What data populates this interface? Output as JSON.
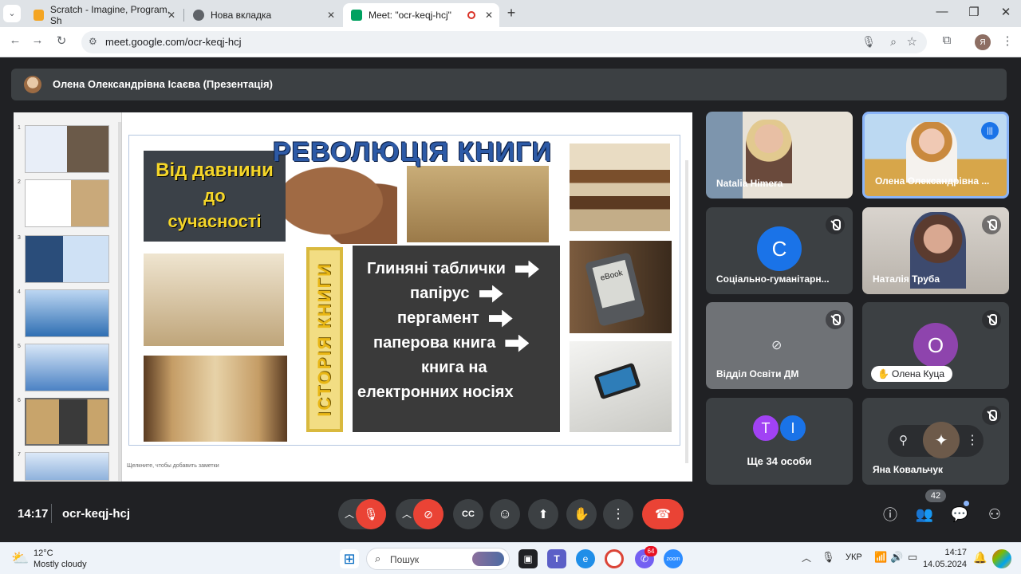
{
  "browser": {
    "tabs": [
      {
        "title": "Scratch - Imagine, Program, Sh",
        "favicon_color": "#f4a522"
      },
      {
        "title": "Нова вкладка",
        "favicon_color": "#5f6368"
      },
      {
        "title": "Meet: \"ocr-keqj-hcj\"",
        "favicon_color": "#00a160"
      }
    ],
    "url": "meet.google.com/ocr-keqj-hcj",
    "profile_initial": "Я"
  },
  "meet": {
    "presenter": "Олена Олександрівна Ісаєва (Презентація)",
    "time": "14:17",
    "meeting_code": "ocr-keqj-hcj",
    "participant_count": "42",
    "participants": [
      {
        "name": "Natalia Himera"
      },
      {
        "name": "Олена Олександрівна ..."
      },
      {
        "name": "Соціально-гуманітарн...",
        "initial": "С",
        "color": "#1a73e8"
      },
      {
        "name": "Наталія Труба"
      },
      {
        "name": "Відділ Освіти ДМ"
      },
      {
        "name": "Олена Куца",
        "initial": "О",
        "color": "#8e44ad"
      },
      {
        "name": "Ще 34 особи",
        "initials": [
          "Т",
          "І"
        ],
        "colors": [
          "#a142f4",
          "#1a73e8"
        ]
      },
      {
        "name": "Яна Ковальчук"
      }
    ]
  },
  "slide": {
    "title": "РЕВОЛЮЦІЯ КНИГИ",
    "ages_lines": [
      "Від давнини",
      "до",
      "сучасності"
    ],
    "spine_text": "ІСТОРІЯ КНИГИ",
    "items": [
      "Глиняні таблички",
      "папірус",
      "пергамент",
      "паперова книга",
      "книга на",
      "електронних носіях"
    ],
    "ebook_label": "eBook",
    "notes_hint": "Щелкните, чтобы добавить заметки"
  },
  "taskbar": {
    "temp": "12°C",
    "weather": "Mostly cloudy",
    "search": "Пошук",
    "lang": "УКР",
    "clock_time": "14:17",
    "clock_date": "14.05.2024",
    "badge": "64"
  }
}
